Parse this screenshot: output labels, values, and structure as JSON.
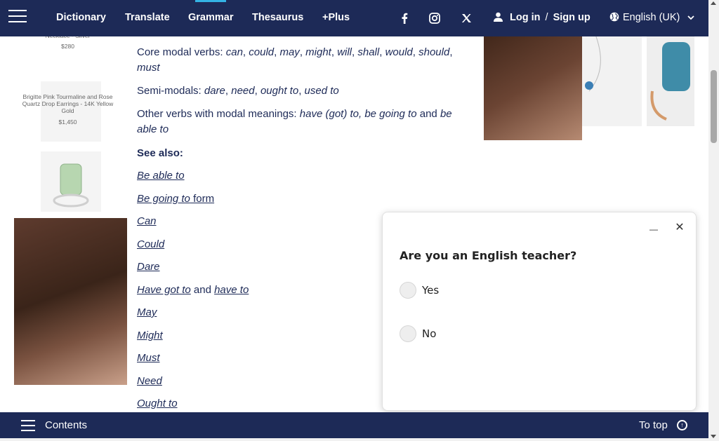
{
  "nav": {
    "items": [
      {
        "label": "Dictionary"
      },
      {
        "label": "Translate"
      },
      {
        "label": "Grammar"
      },
      {
        "label": "Thesaurus"
      },
      {
        "label": "+Plus"
      }
    ],
    "login": "Log in",
    "separator": "/",
    "signup": "Sign up",
    "language": "English (UK)",
    "social": [
      "facebook-icon",
      "instagram-icon",
      "x-icon"
    ]
  },
  "left_ad": {
    "products": [
      {
        "name": "Necklace - Silver",
        "price": "$280"
      },
      {
        "name": "Brigitte Pink Tourmaline and Rose Quartz Drop Earrings - 14K Yellow Gold",
        "price": "$1,450"
      }
    ]
  },
  "content": {
    "core_label": "Core modal verbs:",
    "core_verbs": [
      "can",
      "could",
      "may",
      "might",
      "will",
      "shall",
      "would",
      "should",
      "must"
    ],
    "semi_label": "Semi-modals:",
    "semi_verbs": [
      "dare",
      "need",
      "ought to",
      "used to"
    ],
    "other_label": "Other verbs with modal meanings:",
    "other_verbs_1": "have (got) to, be going to",
    "other_and": "and",
    "other_verbs_2": "be able to",
    "see_also": "See also:",
    "links": [
      {
        "label": "Be able to"
      },
      {
        "label": "Be going to",
        "extra": " form"
      },
      {
        "label": "Can"
      },
      {
        "label": "Could"
      },
      {
        "label": "Dare"
      },
      {
        "label": "Have got to",
        "extra_text": " and ",
        "extra_link": "have to"
      },
      {
        "label": "May"
      },
      {
        "label": "Might"
      },
      {
        "label": "Must"
      },
      {
        "label": "Need"
      },
      {
        "label": "Ought to"
      }
    ]
  },
  "survey": {
    "question": "Are you an English teacher?",
    "options": [
      "Yes",
      "No"
    ]
  },
  "bottom": {
    "contents": "Contents",
    "to_top": "To top"
  }
}
